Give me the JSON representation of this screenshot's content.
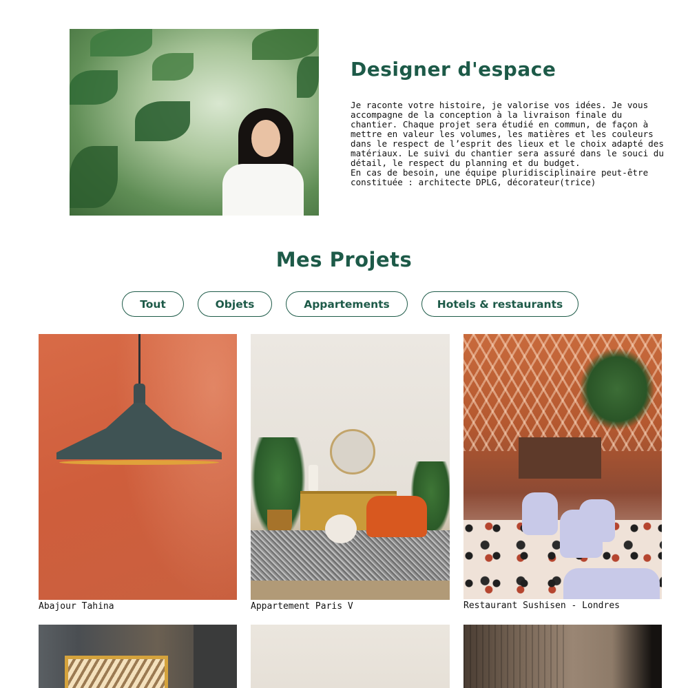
{
  "about": {
    "photo_alt": "portrait",
    "title": "Designer d'espace",
    "paragraphs": [
      "Je raconte votre histoire, je valorise vos idées. Je vous accompagne de la conception à la livraison finale du chantier. Chaque projet sera étudié en commun, de façon à mettre en valeur les volumes, les matières et les couleurs dans le respect de l’esprit des lieux et le choix adapté des matériaux. Le suivi du chantier sera assuré dans le souci du détail, le respect du planning et du budget.",
      "En cas de besoin, une équipe pluridisciplinaire peut-être constituée : architecte DPLG, décorateur(trice)"
    ]
  },
  "projects": {
    "title": "Mes Projets",
    "filters": [
      "Tout",
      "Objets",
      "Appartements",
      "Hotels & restaurants"
    ],
    "items": [
      {
        "caption": "Abajour Tahina"
      },
      {
        "caption": "Appartement Paris V"
      },
      {
        "caption": "Restaurant Sushisen - Londres"
      }
    ]
  },
  "colors": {
    "accent": "#1d5a48",
    "background": "#ffffff",
    "text": "#111111"
  }
}
